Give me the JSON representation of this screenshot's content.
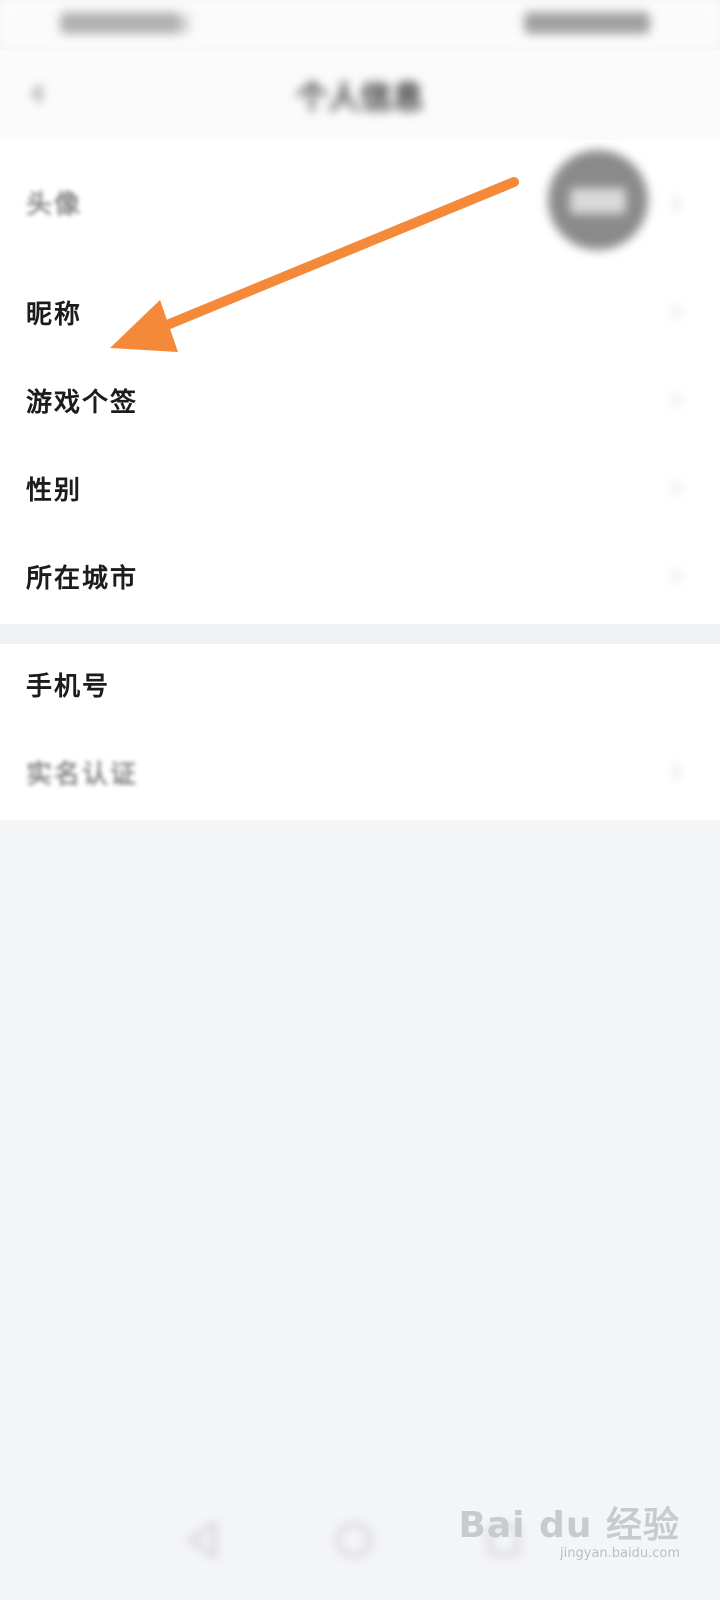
{
  "status_bar": {
    "time": ""
  },
  "header": {
    "title": "个人信息",
    "back_icon": "chevron-left-icon"
  },
  "profile_card": {
    "avatar_label": "头像",
    "rows": [
      {
        "label": "昵称",
        "value": ""
      },
      {
        "label": "游戏个签",
        "value": ""
      },
      {
        "label": "性别",
        "value": ""
      },
      {
        "label": "所在城市",
        "value": ""
      }
    ]
  },
  "account_card": {
    "rows": [
      {
        "label": "手机号",
        "value": ""
      },
      {
        "label": "实名认证",
        "value": ""
      }
    ]
  },
  "annotation": {
    "arrow_color": "#f5893a",
    "points_to": "昵称"
  },
  "nav_bar": {
    "icons": [
      "back-triangle-icon",
      "home-circle-icon",
      "recent-square-icon"
    ]
  },
  "watermark": {
    "title": "Bai du 经验",
    "subtitle": "jingyan.baidu.com"
  },
  "colors": {
    "background": "#f4f5f7",
    "card": "#ffffff",
    "arrow": "#f5893a"
  }
}
